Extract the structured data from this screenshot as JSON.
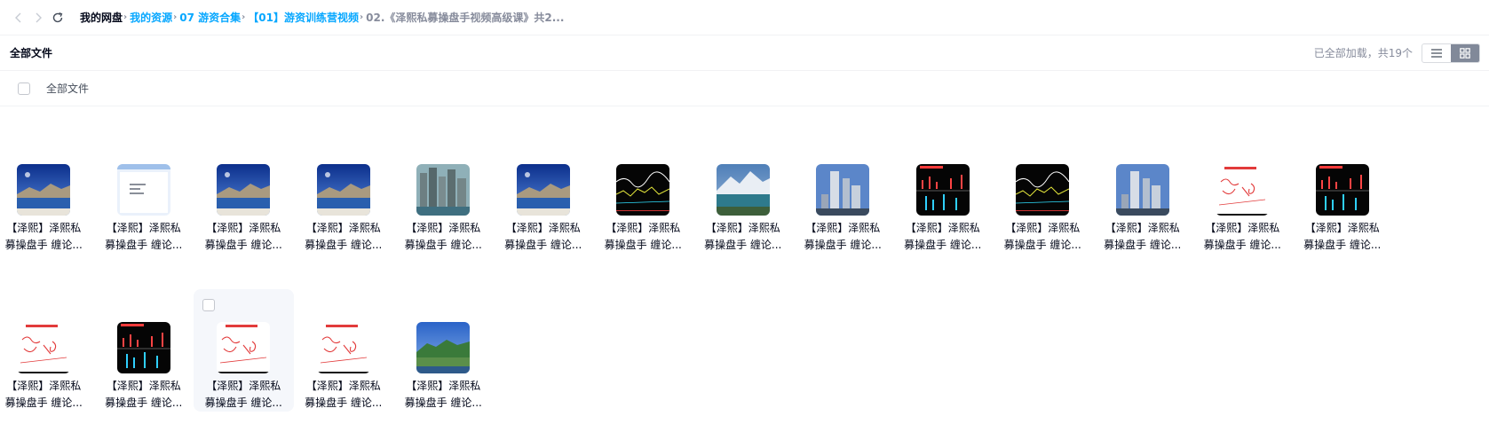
{
  "nav": {
    "breadcrumbs": [
      "我的网盘",
      "我的资源",
      "07 游资合集",
      "【01】游资训练营视频",
      "02.《泽熙私募操盘手视频高级课》共2..."
    ]
  },
  "header": {
    "title": "全部文件",
    "count_text": "已全部加载，共19个"
  },
  "select_all_label": "全部文件",
  "files": [
    {
      "line1": "【泽熙】泽熙私",
      "line2": "募操盘手 缠论...",
      "thumb": "lake"
    },
    {
      "line1": "【泽熙】泽熙私",
      "line2": "募操盘手 缠论...",
      "thumb": "doc"
    },
    {
      "line1": "【泽熙】泽熙私",
      "line2": "募操盘手 缠论...",
      "thumb": "lake"
    },
    {
      "line1": "【泽熙】泽熙私",
      "line2": "募操盘手 缠论...",
      "thumb": "lake"
    },
    {
      "line1": "【泽熙】泽熙私",
      "line2": "募操盘手 缠论...",
      "thumb": "city"
    },
    {
      "line1": "【泽熙】泽熙私",
      "line2": "募操盘手 缠论...",
      "thumb": "lake"
    },
    {
      "line1": "【泽熙】泽熙私",
      "line2": "募操盘手 缠论...",
      "thumb": "chart"
    },
    {
      "line1": "【泽熙】泽熙私",
      "line2": "募操盘手 缠论...",
      "thumb": "mountain"
    },
    {
      "line1": "【泽熙】泽熙私",
      "line2": "募操盘手 缠论...",
      "thumb": "tower"
    },
    {
      "line1": "【泽熙】泽熙私",
      "line2": "募操盘手 缠论...",
      "thumb": "chart2"
    },
    {
      "line1": "【泽熙】泽熙私",
      "line2": "募操盘手 缠论...",
      "thumb": "chart"
    },
    {
      "line1": "【泽熙】泽熙私",
      "line2": "募操盘手 缠论...",
      "thumb": "tower"
    },
    {
      "line1": "【泽熙】泽熙私",
      "line2": "募操盘手 缠论...",
      "thumb": "whiteboard"
    },
    {
      "line1": "【泽熙】泽熙私",
      "line2": "募操盘手 缠论...",
      "thumb": "chart2"
    },
    {
      "line1": "【泽熙】泽熙私",
      "line2": "募操盘手 缠论...",
      "thumb": "whiteboard"
    },
    {
      "line1": "【泽熙】泽熙私",
      "line2": "募操盘手 缠论...",
      "thumb": "chart2"
    },
    {
      "line1": "【泽熙】泽熙私",
      "line2": "募操盘手 缠论...",
      "thumb": "whiteboard"
    },
    {
      "line1": "【泽熙】泽熙私",
      "line2": "募操盘手 缠论...",
      "thumb": "whiteboard"
    },
    {
      "line1": "【泽熙】泽熙私",
      "line2": "募操盘手 缠论...",
      "thumb": "forest"
    }
  ],
  "colors": {
    "accent": "#06a7ff",
    "muted": "#878c9c",
    "hover_bg": "#f5f7fb"
  }
}
